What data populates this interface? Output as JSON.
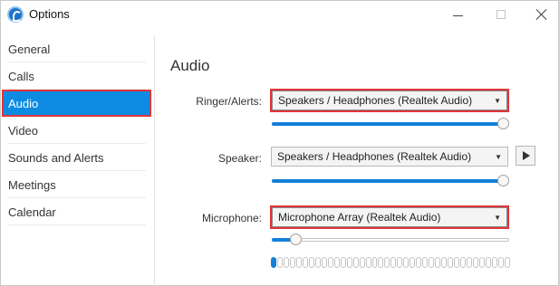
{
  "window": {
    "title": "Options",
    "app_icon": "app-logo-icon",
    "controls": [
      "minimize-icon",
      "maximize-icon",
      "close-icon"
    ]
  },
  "sidebar": {
    "items": [
      {
        "label": "General"
      },
      {
        "label": "Calls"
      },
      {
        "label": "Audio",
        "selected": true
      },
      {
        "label": "Video"
      },
      {
        "label": "Sounds and Alerts"
      },
      {
        "label": "Meetings"
      },
      {
        "label": "Calendar"
      }
    ]
  },
  "main": {
    "title": "Audio",
    "ringer": {
      "label": "Ringer/Alerts:",
      "value": "Speakers / Headphones (Realtek Audio)",
      "volume_percent": 100
    },
    "speaker": {
      "label": "Speaker:",
      "value": "Speakers / Headphones (Realtek Audio)",
      "volume_percent": 100,
      "play_icon": "play-icon"
    },
    "microphone": {
      "label": "Microphone:",
      "value": "Microphone Array (Realtek Audio)",
      "volume_percent": 10,
      "level_segments_total": 38,
      "level_segments_active": 1
    }
  },
  "colors": {
    "accent": "#0d8be3",
    "highlight_border": "#e0353a",
    "slider_fill": "#1380d9"
  }
}
